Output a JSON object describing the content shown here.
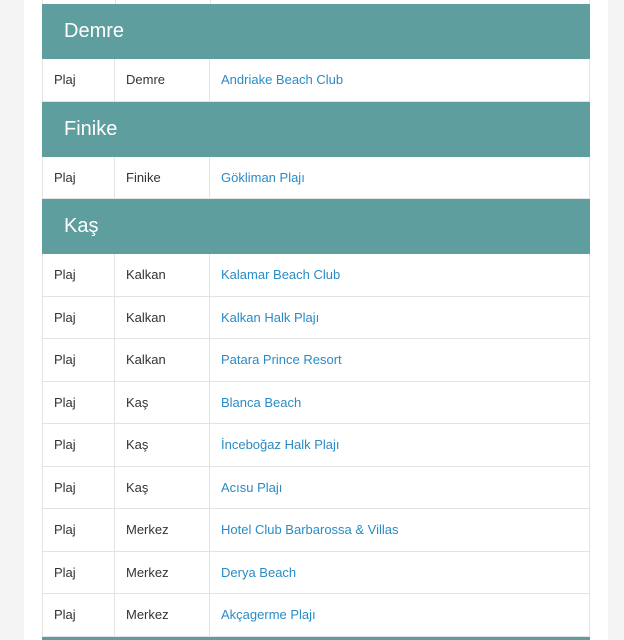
{
  "groups": [
    {
      "name": "Demre",
      "rows": [
        {
          "type": "Plaj",
          "district": "Demre",
          "venue": "Andriake Beach Club"
        }
      ]
    },
    {
      "name": "Finike",
      "rows": [
        {
          "type": "Plaj",
          "district": "Finike",
          "venue": "Gökliman Plajı"
        }
      ]
    },
    {
      "name": "Kaş",
      "rows": [
        {
          "type": "Plaj",
          "district": "Kalkan",
          "venue": "Kalamar Beach Club"
        },
        {
          "type": "Plaj",
          "district": "Kalkan",
          "venue": "Kalkan Halk Plajı"
        },
        {
          "type": "Plaj",
          "district": "Kalkan",
          "venue": "Patara Prince Resort"
        },
        {
          "type": "Plaj",
          "district": "Kaş",
          "venue": "Blanca Beach"
        },
        {
          "type": "Plaj",
          "district": "Kaş",
          "venue": "İnceboğaz Halk Plajı"
        },
        {
          "type": "Plaj",
          "district": "Kaş",
          "venue": "Acısu Plajı"
        },
        {
          "type": "Plaj",
          "district": "Merkez",
          "venue": "Hotel Club Barbarossa & Villas"
        },
        {
          "type": "Plaj",
          "district": "Merkez",
          "venue": "Derya Beach"
        },
        {
          "type": "Plaj",
          "district": "Merkez",
          "venue": "Akçagerme Plajı"
        }
      ]
    }
  ],
  "colors": {
    "header_bg": "#5f9e9e",
    "link": "#2a8bc5",
    "border": "#e3e3e3"
  }
}
